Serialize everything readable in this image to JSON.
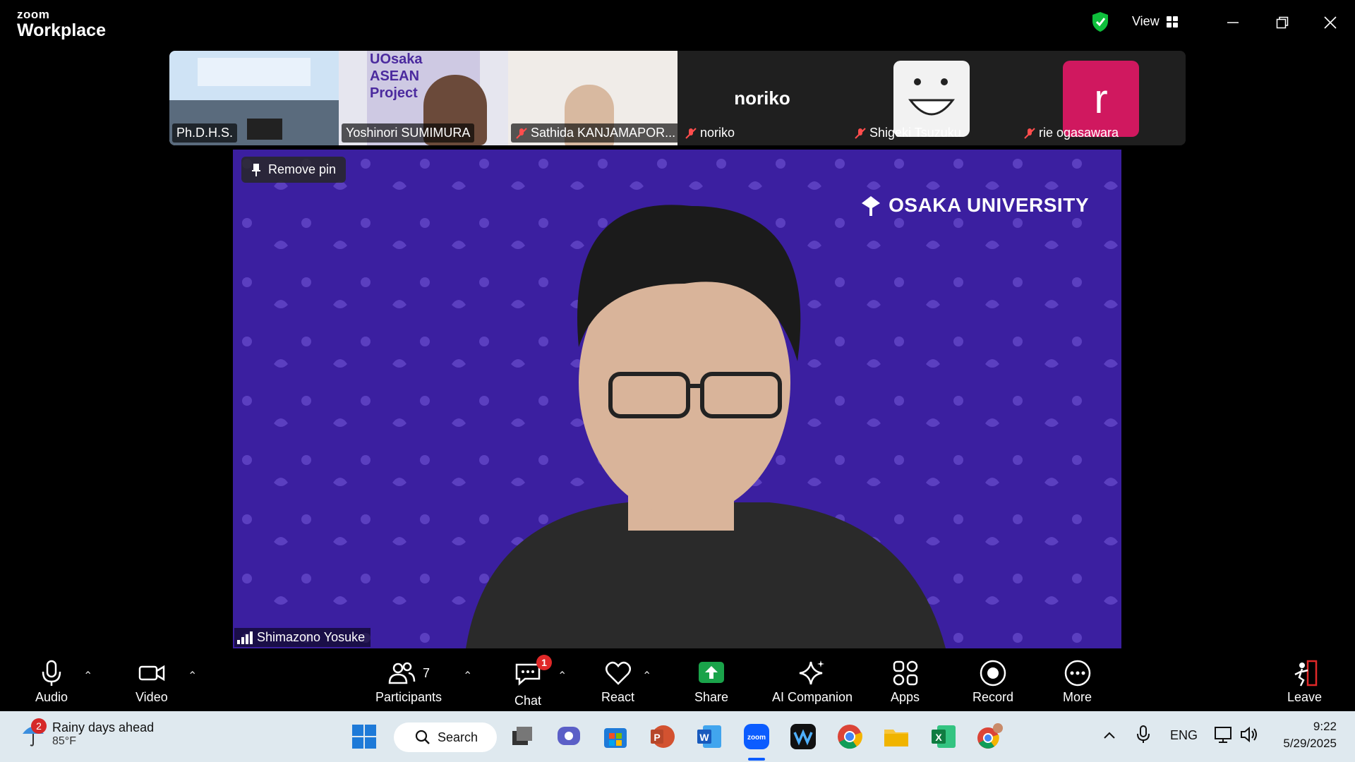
{
  "app": {
    "brand_small": "zoom",
    "brand_large": "Workplace",
    "view_label": "View"
  },
  "thumbnails": [
    {
      "name": "Ph.D.H.S.",
      "muted": false,
      "kind": "video-room"
    },
    {
      "name": "Yoshinori SUMIMURA",
      "muted": false,
      "kind": "video-person",
      "bg_text": [
        "UOsaka",
        "ASEAN",
        "Project"
      ]
    },
    {
      "name": "Sathida KANJAMAPOR...",
      "muted": true,
      "kind": "video-person"
    },
    {
      "name": "noriko",
      "muted": true,
      "kind": "text",
      "display": "noriko"
    },
    {
      "name": "Shigeki Tsuzuku",
      "muted": true,
      "kind": "avatar"
    },
    {
      "name": "rie ogasawara",
      "muted": true,
      "kind": "letter",
      "letter": "r",
      "color": "#d0185f"
    }
  ],
  "main": {
    "pin_label": "Remove pin",
    "org_logo": "OSAKA UNIVERSITY",
    "speaker_name": "Shimazono Yosuke",
    "bg_color": "#3b1fa0"
  },
  "toolbar": {
    "audio": "Audio",
    "video": "Video",
    "participants": "Participants",
    "participants_count": "7",
    "chat": "Chat",
    "chat_badge": "1",
    "react": "React",
    "share": "Share",
    "ai": "AI Companion",
    "apps": "Apps",
    "record": "Record",
    "more": "More",
    "leave": "Leave"
  },
  "taskbar": {
    "weather_badge": "2",
    "weather_title": "Rainy days ahead",
    "weather_temp": "85°F",
    "search_label": "Search",
    "lang": "ENG",
    "time": "9:22",
    "date": "5/29/2025"
  },
  "colors": {
    "share_green": "#1aa34a",
    "accent_blue": "#0b5cff",
    "shield_green": "#0fbf3c"
  }
}
